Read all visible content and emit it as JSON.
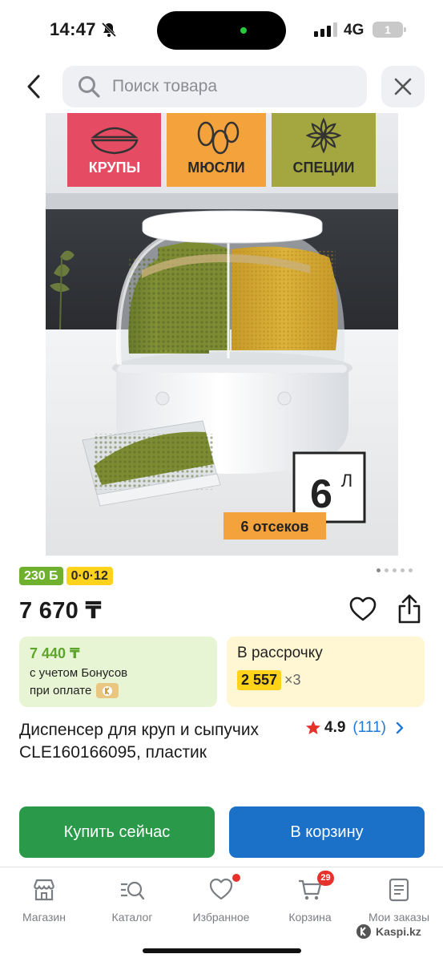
{
  "status": {
    "time": "14:47",
    "network": "4G",
    "battery": "1"
  },
  "search": {
    "placeholder": "Поиск товара"
  },
  "image": {
    "labels": [
      "КРУПЫ",
      "МЮСЛИ",
      "СПЕЦИИ"
    ],
    "volume_number": "6",
    "volume_unit": "Л",
    "compartments_label": "6 отсеков",
    "gallery_pages": 5,
    "gallery_current": 1
  },
  "badges": {
    "bonus": "230 Б",
    "installment": "0·0·12"
  },
  "price": "7 670 ₸",
  "bonus_card": {
    "value": "7 440 ₸",
    "line1": "с учетом Бонусов",
    "line2": "при оплате"
  },
  "credit_card": {
    "label": "В рассрочку",
    "amount": "2 557",
    "multiplier": "×3"
  },
  "product": {
    "title": "Диспенсер для круп и сыпучих CLE160166095, пластик",
    "rating": "4.9",
    "reviews": "(111)"
  },
  "buttons": {
    "buy_now": "Купить сейчас",
    "add_to_cart": "В корзину"
  },
  "nav": {
    "shop": "Магазин",
    "catalog": "Каталог",
    "favorites": "Избранное",
    "cart": "Корзина",
    "cart_count": "29",
    "orders": "Мои заказы"
  },
  "watermark": "Kaspi.kz",
  "colors": {
    "buy_green": "#2a9a4a",
    "cart_blue": "#1b71c8",
    "bonus_green": "#6fb02c",
    "installment_yellow": "#ffd21c",
    "link_blue": "#1f7ad8",
    "badge_red": "#e5322d"
  }
}
